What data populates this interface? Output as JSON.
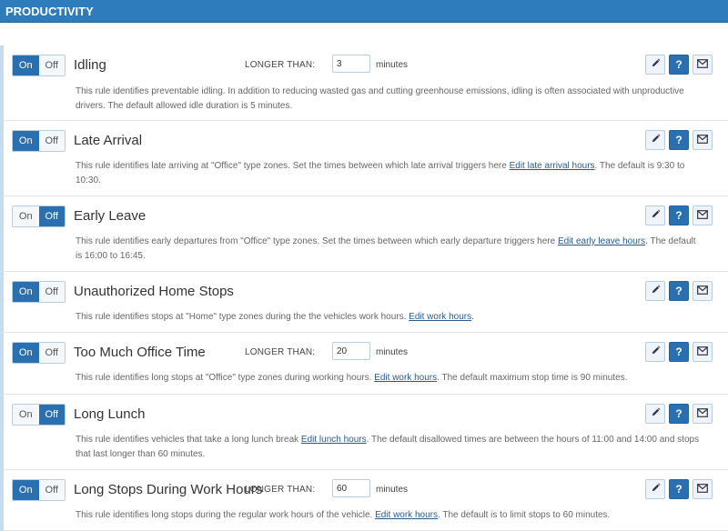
{
  "section": {
    "title": "PRODUCTIVITY"
  },
  "labels": {
    "on": "On",
    "off": "Off"
  },
  "rules": [
    {
      "title": "Idling",
      "state": "on",
      "threshold": {
        "label": "LONGER THAN:",
        "value": "3",
        "unit": "minutes"
      },
      "description": {
        "before": "This rule identifies preventable idling. In addition to reducing wasted gas and cutting greenhouse emissions, idling is often associated with unproductive drivers. The default allowed idle duration is 5 minutes.",
        "link": "",
        "after": ""
      }
    },
    {
      "title": "Late Arrival",
      "state": "on",
      "threshold": null,
      "description": {
        "before": "This rule identifies late arriving at \"Office\" type zones. Set the times between which late arrival triggers here ",
        "link": "Edit late arrival hours",
        "after": ". The default is 9:30 to 10:30."
      }
    },
    {
      "title": "Early Leave",
      "state": "off",
      "threshold": null,
      "description": {
        "before": "This rule identifies early departures from \"Office\" type zones. Set the times between which early departure triggers here ",
        "link": "Edit early leave hours",
        "after": ". The default is 16:00 to 16:45."
      }
    },
    {
      "title": "Unauthorized Home Stops",
      "state": "on",
      "threshold": null,
      "description": {
        "before": "This rule identifies stops at \"Home\" type zones during the the vehicles work hours. ",
        "link": "Edit work hours",
        "after": "."
      }
    },
    {
      "title": "Too Much Office Time",
      "state": "on",
      "threshold": {
        "label": "LONGER THAN:",
        "value": "20",
        "unit": "minutes"
      },
      "description": {
        "before": "This rule identifies long stops at \"Office\" type zones during working hours. ",
        "link": "Edit work hours",
        "after": ". The default maximum stop time is 90 minutes."
      }
    },
    {
      "title": "Long Lunch",
      "state": "off",
      "threshold": null,
      "description": {
        "before": "This rule identifies vehicles that take a long lunch break ",
        "link": "Edit lunch hours",
        "after": ". The default disallowed times are between the hours of 11:00 and 14:00 and stops that last longer than 60 minutes."
      }
    },
    {
      "title": "Long Stops During Work Hours",
      "state": "on",
      "threshold": {
        "label": "LONGER THAN:",
        "value": "60",
        "unit": "minutes"
      },
      "description": {
        "before": "This rule identifies long stops during the regular work hours of the vehicle. ",
        "link": "Edit work hours",
        "after": ". The default is to limit stops to 60 minutes."
      }
    }
  ],
  "icons": {
    "edit": "pencil-icon",
    "help": "help-icon",
    "email": "envelope-icon"
  },
  "colors": {
    "header": "#2f7cbd",
    "active_toggle": "#2a6fb0",
    "help_button": "#2a6fb0"
  }
}
